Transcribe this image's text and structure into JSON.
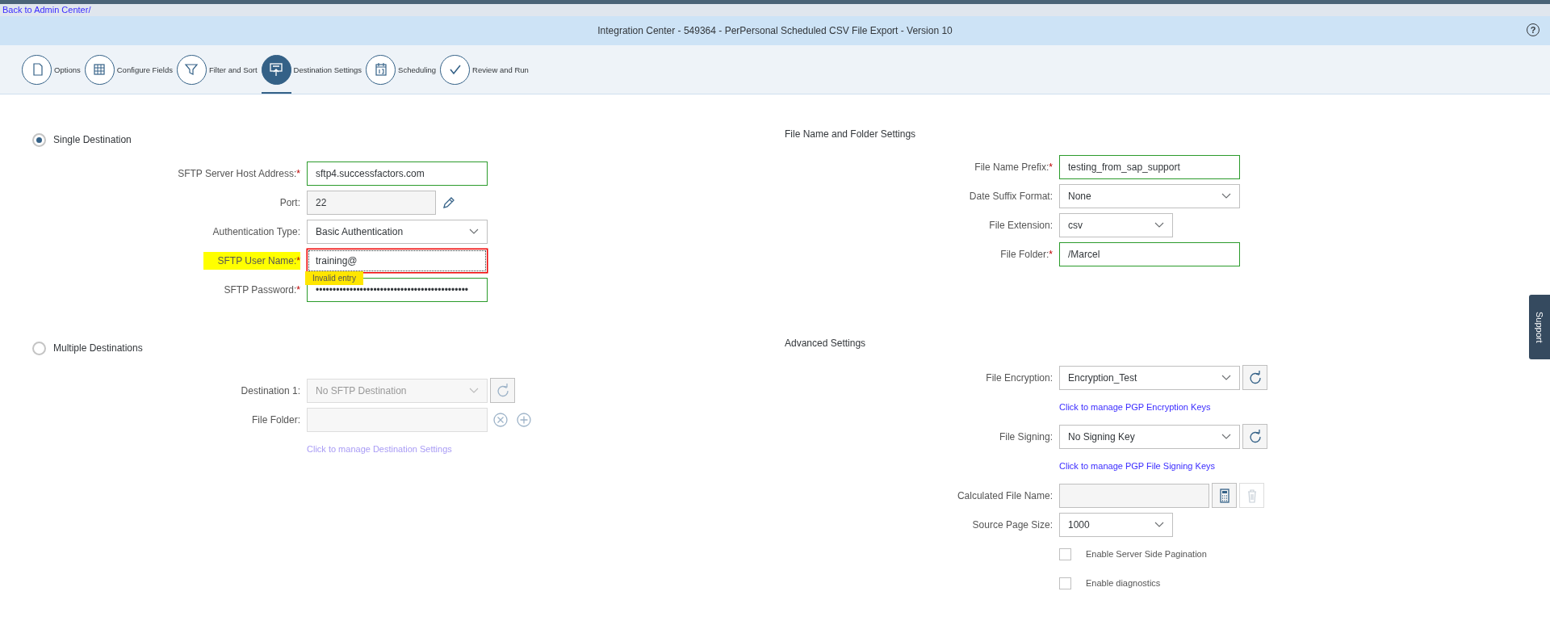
{
  "back_link": "Back to Admin Center/",
  "window": {
    "title": "Integration Center - 549364 - PerPersonal Scheduled CSV File Export - Version 10",
    "help": "?"
  },
  "steps": [
    {
      "label": "Options",
      "selected": false
    },
    {
      "label": "Configure Fields",
      "selected": false
    },
    {
      "label": "Filter and Sort",
      "selected": false
    },
    {
      "label": "Destination Settings",
      "selected": true
    },
    {
      "label": "Scheduling",
      "selected": false
    },
    {
      "label": "Review and Run",
      "selected": false
    }
  ],
  "destinations": [
    {
      "label": "Single Destination",
      "selected": true,
      "items": [
        {
          "kind": "text",
          "label": "SFTP Server Host Address:",
          "required_mark": "*",
          "highlighted": false,
          "success": true,
          "error": false,
          "disabled": false,
          "value": "sftp4.successfactors.com"
        },
        {
          "kind": "readonly",
          "label": "Port:",
          "highlighted": false,
          "success": false,
          "error": false,
          "disabled": false,
          "value": "22",
          "actions": [
            {
              "kind": "edit",
              "disabled": false
            }
          ]
        },
        {
          "kind": "select",
          "label": "Authentication Type:",
          "highlighted": false,
          "success": false,
          "error": false,
          "disabled": false,
          "value": "Basic Authentication"
        },
        {
          "kind": "text",
          "label": "SFTP User Name:",
          "required_mark": "*",
          "highlighted": true,
          "success": false,
          "error": true,
          "disabled": false,
          "value": "training@",
          "message": "Invalid entry"
        },
        {
          "kind": "password",
          "label": "SFTP Password:",
          "required_mark": "*",
          "highlighted": false,
          "success": true,
          "error": false,
          "disabled": false,
          "value": "•••••••••••••••••••••••••••••••••••••••••••••"
        }
      ]
    },
    {
      "label": "Multiple Destinations",
      "selected": false,
      "items": [
        {
          "kind": "select",
          "label": "Destination 1:",
          "highlighted": false,
          "success": false,
          "error": false,
          "disabled": true,
          "value": "No SFTP Destination",
          "actions": [
            {
              "kind": "refresh",
              "disabled": false
            }
          ]
        },
        {
          "kind": "text",
          "label": "File Folder:",
          "highlighted": false,
          "success": false,
          "error": false,
          "disabled": true,
          "actions": [
            {
              "kind": "clear",
              "disabled": false
            },
            {
              "kind": "add",
              "disabled": false
            }
          ]
        },
        {
          "kind": "link",
          "text": "Click to manage Destination Settings",
          "disabled": true
        }
      ]
    }
  ],
  "file_settings": {
    "title": "File Name and Folder Settings",
    "items": [
      {
        "kind": "text",
        "label": "File Name Prefix:",
        "required_mark": "*",
        "highlighted": false,
        "success": true,
        "error": false,
        "disabled": false,
        "value": "testing_from_sap_support"
      },
      {
        "kind": "select",
        "label": "Date Suffix Format:",
        "highlighted": false,
        "success": false,
        "error": false,
        "disabled": false,
        "value": "None"
      },
      {
        "kind": "select",
        "label": "File Extension:",
        "highlighted": false,
        "success": false,
        "error": false,
        "disabled": false,
        "value": "csv",
        "narrow": true
      },
      {
        "kind": "text",
        "label": "File Folder:",
        "required_mark": "*",
        "highlighted": false,
        "success": true,
        "error": false,
        "disabled": false,
        "value": "/Marcel"
      }
    ]
  },
  "advanced_settings": {
    "title": "Advanced Settings",
    "items": [
      {
        "kind": "select",
        "label": "File Encryption:",
        "highlighted": false,
        "success": false,
        "error": false,
        "disabled": false,
        "value": "Encryption_Test",
        "actions": [
          {
            "kind": "refresh",
            "disabled": false
          }
        ]
      },
      {
        "kind": "link",
        "text": "Click to manage PGP Encryption Keys",
        "disabled": false
      },
      {
        "kind": "select",
        "label": "File Signing:",
        "highlighted": false,
        "success": false,
        "error": false,
        "disabled": false,
        "value": "No Signing Key",
        "actions": [
          {
            "kind": "refresh",
            "disabled": false
          }
        ]
      },
      {
        "kind": "link",
        "text": "Click to manage PGP File Signing Keys",
        "disabled": false
      },
      {
        "kind": "readonly",
        "label": "Calculated File Name:",
        "highlighted": false,
        "success": false,
        "error": false,
        "disabled": false,
        "actions": [
          {
            "kind": "calculator",
            "disabled": false
          },
          {
            "kind": "delete",
            "disabled": true
          }
        ]
      },
      {
        "kind": "select",
        "label": "Source Page Size:",
        "highlighted": false,
        "success": false,
        "error": false,
        "disabled": false,
        "value": "1000",
        "narrow": true
      },
      {
        "kind": "checkbox",
        "label": "Enable Server Side Pagination",
        "checked": false
      },
      {
        "kind": "checkbox",
        "label": "Enable diagnostics",
        "checked": false
      }
    ]
  },
  "support_tab": "Support"
}
